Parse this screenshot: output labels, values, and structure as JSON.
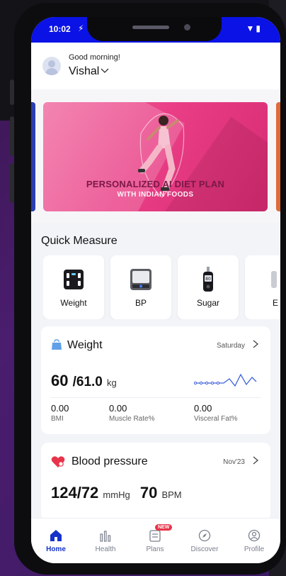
{
  "status_bar": {
    "time": "10:02",
    "left_icon": "bolt-icon",
    "right_icons": "wifi-icon battery-icon"
  },
  "header": {
    "greeting": "Good morning!",
    "username": "Vishal"
  },
  "banner": {
    "title": "PERSONALIZED AI DIET PLAN",
    "subtitle": "WITH INDIAN FOODS"
  },
  "quick_measure": {
    "title": "Quick Measure",
    "items": [
      {
        "label": "Weight",
        "icon": "scale-icon"
      },
      {
        "label": "BP",
        "icon": "bp-monitor-icon"
      },
      {
        "label": "Sugar",
        "icon": "glucometer-icon"
      },
      {
        "label": "E",
        "icon": "ecg-icon"
      }
    ]
  },
  "weight_card": {
    "title": "Weight",
    "day": "Saturday",
    "current": "60",
    "goal": "/61.0",
    "unit": "kg",
    "metrics": [
      {
        "value": "0.00",
        "label": "BMI"
      },
      {
        "value": "0.00",
        "label": "Muscle Rate%"
      },
      {
        "value": "0.00",
        "label": "Visceral Fat%"
      }
    ]
  },
  "bp_card": {
    "title": "Blood pressure",
    "date": "Nov'23",
    "systolic_diastolic": "124/72",
    "bp_unit": "mmHg",
    "pulse": "70",
    "pulse_unit": "BPM"
  },
  "bottom_nav": {
    "items": [
      {
        "label": "Home",
        "icon": "home-icon",
        "active": true
      },
      {
        "label": "Health",
        "icon": "health-icon"
      },
      {
        "label": "Plans",
        "icon": "plans-icon",
        "badge": "NEW"
      },
      {
        "label": "Discover",
        "icon": "compass-icon"
      },
      {
        "label": "Profile",
        "icon": "profile-icon"
      }
    ]
  },
  "colors": {
    "status_bar": "#0a12e6",
    "accent": "#1632c9",
    "banner": "#ea3f86",
    "badge": "#e8344a"
  }
}
